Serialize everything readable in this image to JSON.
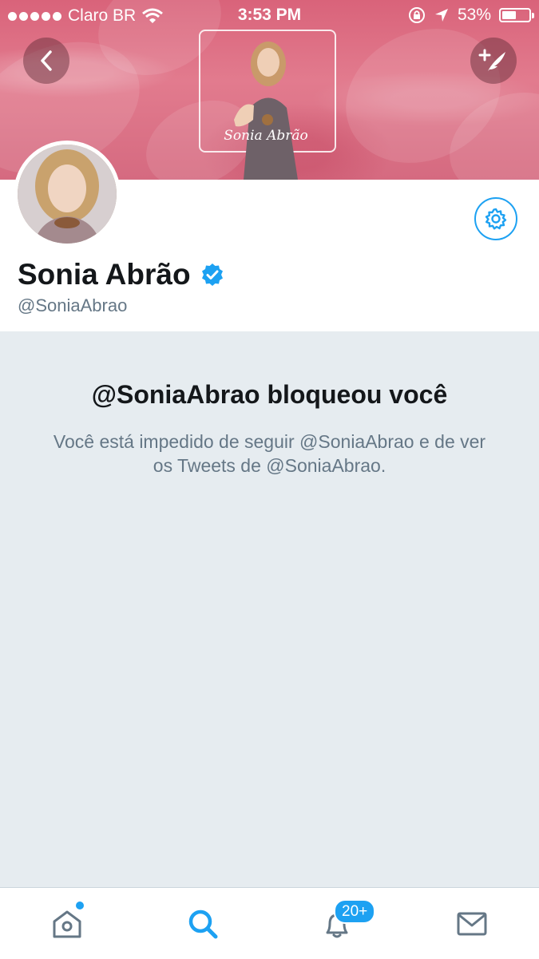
{
  "status_bar": {
    "carrier": "Claro BR",
    "time": "3:53 PM",
    "battery_percent": "53%",
    "battery_level": 0.53,
    "icons": [
      "signal-dots-icon",
      "wifi-icon",
      "orientation-lock-icon",
      "location-arrow-icon",
      "battery-icon"
    ]
  },
  "header": {
    "back_icon": "chevron-left-icon",
    "compose_icon": "compose-tweet-icon",
    "signature": "Sonia Abrão"
  },
  "profile": {
    "name": "Sonia Abrão",
    "handle": "@SoniaAbrao",
    "verified_icon": "verified-badge-icon",
    "settings_icon": "gear-icon"
  },
  "blocked": {
    "title": "@SoniaAbrao bloqueou você",
    "message": "Você está impedido de seguir @SoniaAbrao e de ver os Tweets de @SoniaAbrao."
  },
  "tabbar": {
    "tabs": [
      {
        "name": "home",
        "icon": "home-icon"
      },
      {
        "name": "search",
        "icon": "search-icon"
      },
      {
        "name": "notifications",
        "icon": "bell-icon",
        "badge": "20+"
      },
      {
        "name": "messages",
        "icon": "envelope-icon"
      }
    ]
  },
  "colors": {
    "accent": "#1da1f2",
    "background": "#e6ecf0",
    "banner": "#d9637a",
    "text_primary": "#14171a",
    "text_secondary": "#657786"
  }
}
